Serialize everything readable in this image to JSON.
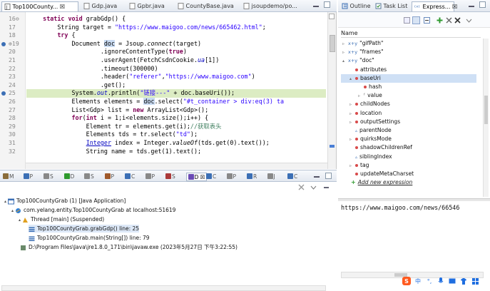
{
  "editor_tabs": [
    {
      "label": "Top100County... ☒",
      "active": true
    },
    {
      "label": "Gdp.java"
    },
    {
      "label": "Gpbr.java"
    },
    {
      "label": "CountyBase.java"
    },
    {
      "label": "jsoupdemo/po..."
    }
  ],
  "line_numbers": [
    "16⊖",
    "17",
    "18",
    "⊕19",
    "20",
    "21",
    "22",
    "23",
    "24",
    "25",
    "26",
    "27",
    "28",
    "29",
    "30",
    "31",
    "32"
  ],
  "code_lines": [
    [
      "    ",
      {
        "k": "kw",
        "t": "static void "
      },
      "grabGdp() {"
    ],
    [
      "        String target = ",
      {
        "k": "str",
        "t": "\"https://www.maigoo.com/news/665462.html\""
      },
      ";"
    ],
    [
      "        ",
      {
        "k": "kw",
        "t": "try"
      },
      " {"
    ],
    [
      "            Document ",
      {
        "k": "sel",
        "t": "doc"
      },
      " = Jsoup.",
      {
        "k": "ital",
        "t": "connect"
      },
      "(target)"
    ],
    [
      "                    .ignoreContentType(",
      {
        "k": "kw",
        "t": "true"
      },
      ")"
    ],
    [
      "                    .userAgent(FetchCsdnCookie.",
      {
        "k": "fld",
        "t": "ua"
      },
      "[1])"
    ],
    [
      "                    .timeout(300000)"
    ],
    [
      "                    .header(",
      {
        "k": "str",
        "t": "\"referer\""
      },
      ",",
      {
        "k": "str",
        "t": "\"https://www.maigoo.com\""
      },
      ")"
    ],
    [
      "                    .get();"
    ],
    [
      "            System.",
      {
        "k": "fld",
        "t": "out"
      },
      ".println(",
      {
        "k": "str",
        "t": "\"链接---\""
      },
      " + doc.baseUri());"
    ],
    [
      "            Elements elements = ",
      {
        "k": "sel",
        "t": "doc"
      },
      ".select(",
      {
        "k": "str",
        "t": "\"#t_container > div:eq(3) ta"
      }
    ],
    [
      "            List<Gdp> list = ",
      {
        "k": "kw",
        "t": "new"
      },
      " ArrayList<Gdp>();"
    ],
    [
      "            ",
      {
        "k": "kw",
        "t": "for"
      },
      "(",
      {
        "k": "kw",
        "t": "int"
      },
      " i = 1;i<elements.size();i++) {"
    ],
    [
      "                Element tr = elements.get(i);",
      {
        "k": "cmt",
        "t": "//获取表头"
      }
    ],
    [
      "                Elements tds = tr.select(",
      {
        "k": "str",
        "t": "\"td\""
      },
      ");"
    ],
    [
      "                ",
      {
        "k": "und",
        "t": "Integer"
      },
      " index = Integer.",
      {
        "k": "ital",
        "t": "valueOf"
      },
      "(tds.get(0).text());"
    ],
    [
      "                String name = tds.get(1).text();"
    ]
  ],
  "debug_tabs": [
    "M",
    "P",
    "S",
    "D",
    "S",
    "P",
    "C",
    "P",
    "S",
    "D ☒",
    "C",
    "P",
    "R",
    "J",
    "C"
  ],
  "debug_tree": [
    {
      "label": "Top100CountyGrab (1) [Java Application]"
    },
    {
      "label": "com.yelang.entity.Top100CountyGrab at localhost:51619"
    },
    {
      "label": "Thread [main] (Suspended)"
    },
    {
      "label": "Top100CountyGrab.grabGdp() line: 25"
    },
    {
      "label": "Top100CountyGrab.main(String[]) line: 79"
    },
    {
      "label": "D:\\Program Files\\Java\\jre1.8.0_171\\bin\\javaw.exe (2023年5月27日 下午3:22:55)"
    }
  ],
  "right_tabs": [
    "Outline",
    "Task List",
    "Express... ☒"
  ],
  "column_header": "Name",
  "variables": [
    {
      "label": "\"gifPath\"",
      "kind": "expr"
    },
    {
      "label": "\"frames\"",
      "kind": "expr"
    },
    {
      "label": "\"doc\"",
      "kind": "expr"
    },
    {
      "label": "attributes",
      "kind": "field"
    },
    {
      "label": "baseUri",
      "kind": "field"
    },
    {
      "label": "hash",
      "kind": "field"
    },
    {
      "label": "value",
      "kind": "final"
    },
    {
      "label": "childNodes",
      "kind": "field"
    },
    {
      "label": "location",
      "kind": "field"
    },
    {
      "label": "outputSettings",
      "kind": "field"
    },
    {
      "label": "parentNode",
      "kind": "tri"
    },
    {
      "label": "quirksMode",
      "kind": "field"
    },
    {
      "label": "shadowChildrenRef",
      "kind": "field"
    },
    {
      "label": "siblingIndex",
      "kind": "tri"
    },
    {
      "label": "tag",
      "kind": "field"
    },
    {
      "label": "updateMetaCharset",
      "kind": "field"
    },
    {
      "label": "Add new expression",
      "kind": "add"
    }
  ],
  "detail_value": "https://www.maigoo.com/news/66546",
  "ime_label": "中",
  "colors": {
    "keyword": "#7f0055",
    "string": "#2a00ff",
    "field": "#0000c0",
    "comment": "#3f7f5f",
    "highlight": "#dcecc3"
  }
}
